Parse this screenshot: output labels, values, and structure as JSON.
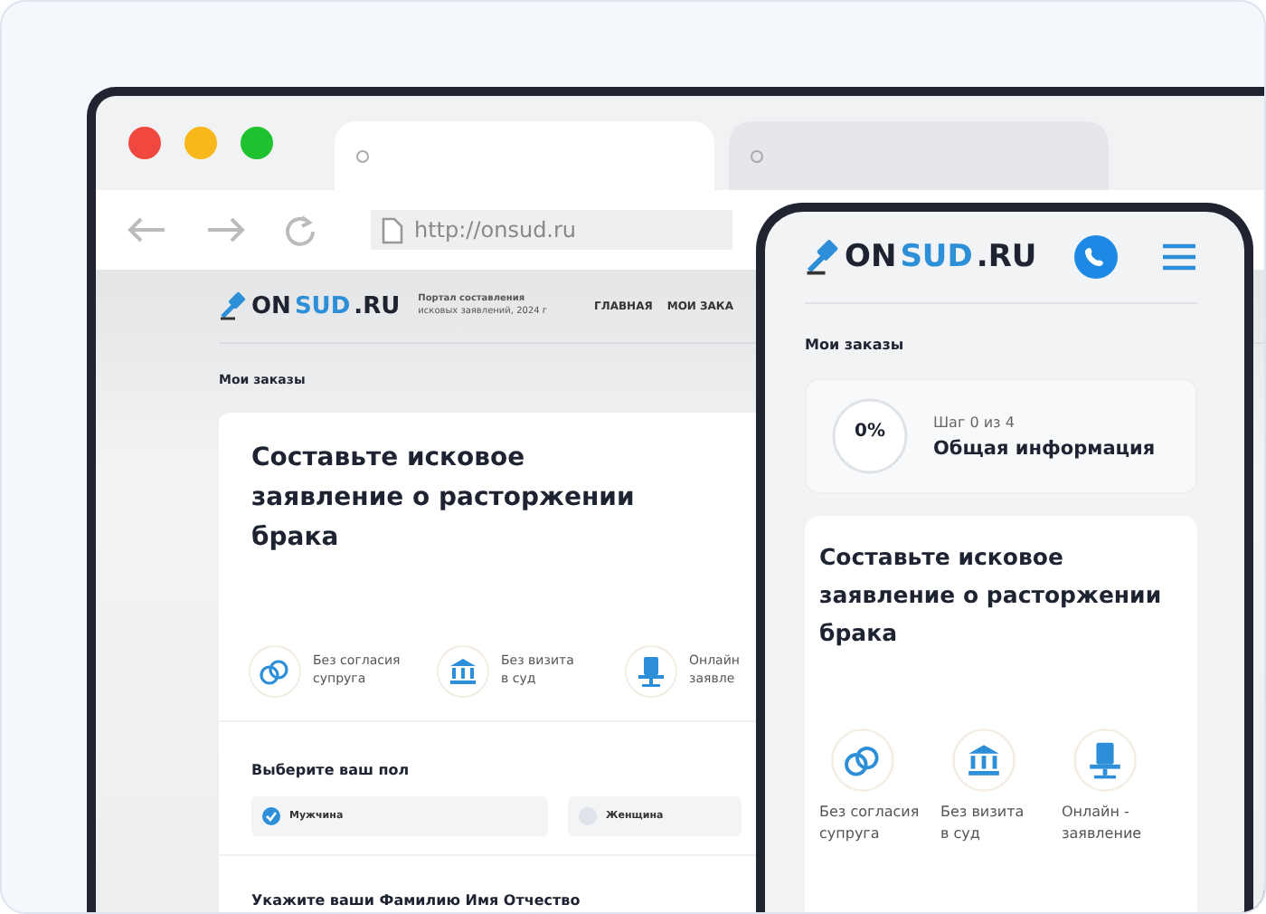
{
  "browser": {
    "tabs": [
      {
        "selected": true
      },
      {
        "selected": false
      }
    ],
    "url": "http://onsud.ru"
  },
  "site": {
    "logo": {
      "dark": "ON",
      "accent": "SUD",
      "suffix": ".RU"
    },
    "tagline": [
      "Портал составления",
      "исковых заявлений, 2024 г"
    ],
    "nav": [
      "ГЛАВНАЯ",
      "МОИ ЗАКА"
    ],
    "breadcrumb": "Мои заказы",
    "title": "Составьте исковое заявление о расторжении брака",
    "features": [
      {
        "kind": "rings",
        "lines": [
          "Без согласия",
          "супруга"
        ]
      },
      {
        "kind": "court",
        "lines": [
          "Без визита",
          "в суд"
        ]
      },
      {
        "kind": "online",
        "lines": [
          "Онлайн",
          "заявле"
        ]
      }
    ],
    "gender": {
      "title": "Выберите ваш пол",
      "options": [
        {
          "label": "Мужчина",
          "selected": true
        },
        {
          "label": "Женщина",
          "selected": false
        }
      ]
    },
    "fio_label": "Укажите ваши Фамилию Имя Отчество"
  },
  "phone": {
    "logo": {
      "dark": "ON",
      "accent": "SUD",
      "suffix": ".RU"
    },
    "breadcrumb": "Мои заказы",
    "progress": {
      "percent": "0%",
      "level": 0,
      "step": "Шаг 0 из 4",
      "title": "Общая информация"
    },
    "title": "Составьте исковое заявление о расторжении брака",
    "features": [
      {
        "kind": "rings",
        "lines": [
          "Без согласия",
          "супруга"
        ]
      },
      {
        "kind": "court",
        "lines": [
          "Без визита",
          "в суд"
        ]
      },
      {
        "kind": "online",
        "lines": [
          "Онлайн -",
          "заявление"
        ]
      }
    ]
  }
}
